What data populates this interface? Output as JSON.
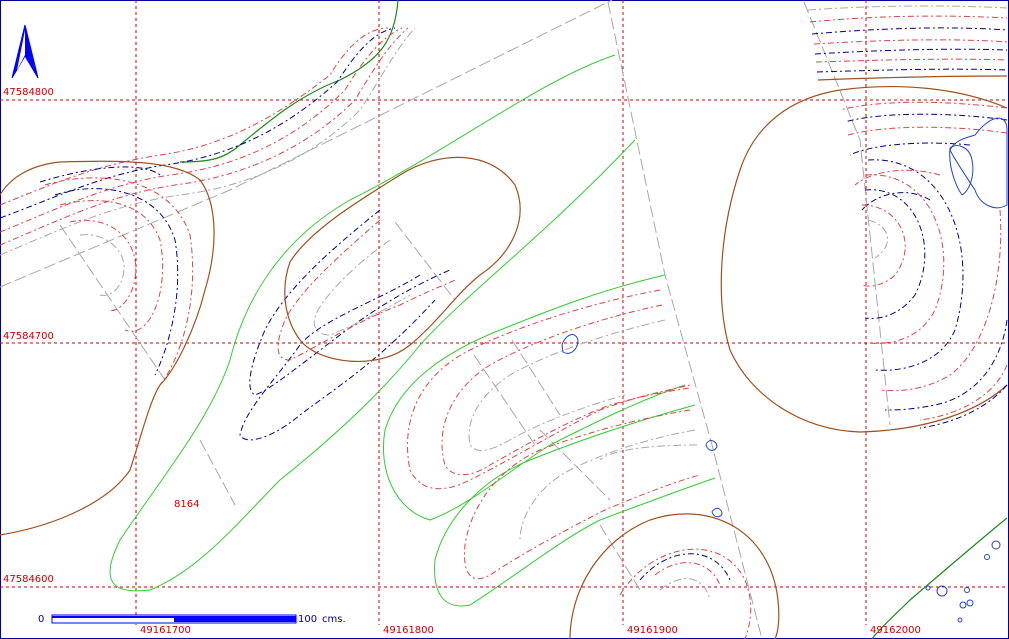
{
  "map": {
    "grid": {
      "x_labels": [
        "49161700",
        "49161800",
        "49161900",
        "49162000"
      ],
      "y_labels": [
        "47584800",
        "47584700",
        "47584600"
      ],
      "line_color": "#cc0000",
      "label_color": "#cc0000"
    },
    "scale_bar": {
      "start_label": "0",
      "end_label": "100",
      "unit_label": "cms.",
      "color": "#0000ff"
    },
    "north_arrow": {
      "icon": "north-arrow-icon",
      "color": "#0000ff"
    },
    "annotation": {
      "text": "8164"
    },
    "colors": {
      "brown_boundary": "#a0521e",
      "green_contour": "#33cc33",
      "dark_green_line": "#1a8a1a",
      "blue_dash": "#00008b",
      "red_dash": "#dd4444",
      "gray_dash": "#a8a8a8",
      "water_blue": "#2244cc"
    }
  }
}
